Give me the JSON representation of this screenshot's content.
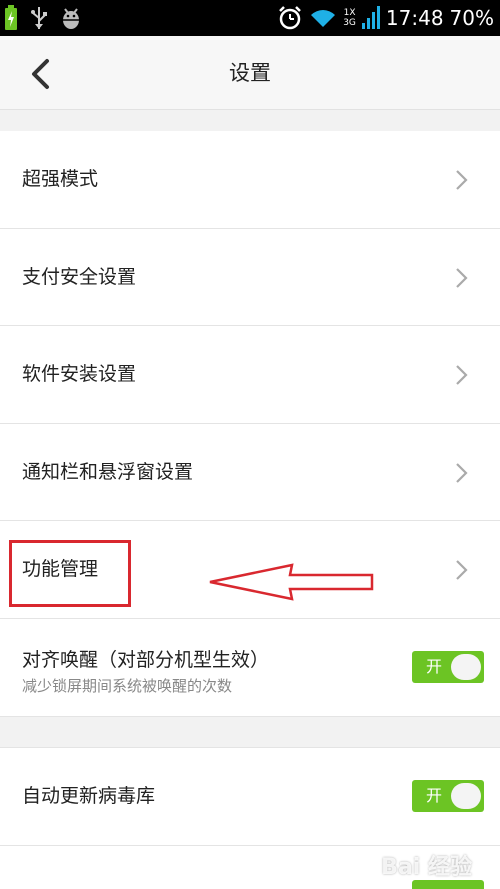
{
  "status_bar": {
    "net_top": "1X",
    "net_bottom": "3G",
    "time": "17:48",
    "battery_percent": "70%"
  },
  "header": {
    "title": "设置"
  },
  "settings": {
    "items": [
      {
        "label": "超强模式"
      },
      {
        "label": "支付安全设置"
      },
      {
        "label": "软件安装设置"
      },
      {
        "label": "通知栏和悬浮窗设置"
      },
      {
        "label": "功能管理"
      }
    ],
    "align_wakeup": {
      "label": "对齐唤醒（对部分机型生效）",
      "sub": "减少锁屏期间系统被唤醒的次数",
      "toggle_text": "开"
    }
  },
  "settings2": {
    "auto_update": {
      "label": "自动更新病毒库",
      "toggle_text": "开"
    }
  },
  "watermark": "Bai  经验",
  "colors": {
    "accent_green": "#6cc424",
    "annotation_red": "#d9282f"
  }
}
